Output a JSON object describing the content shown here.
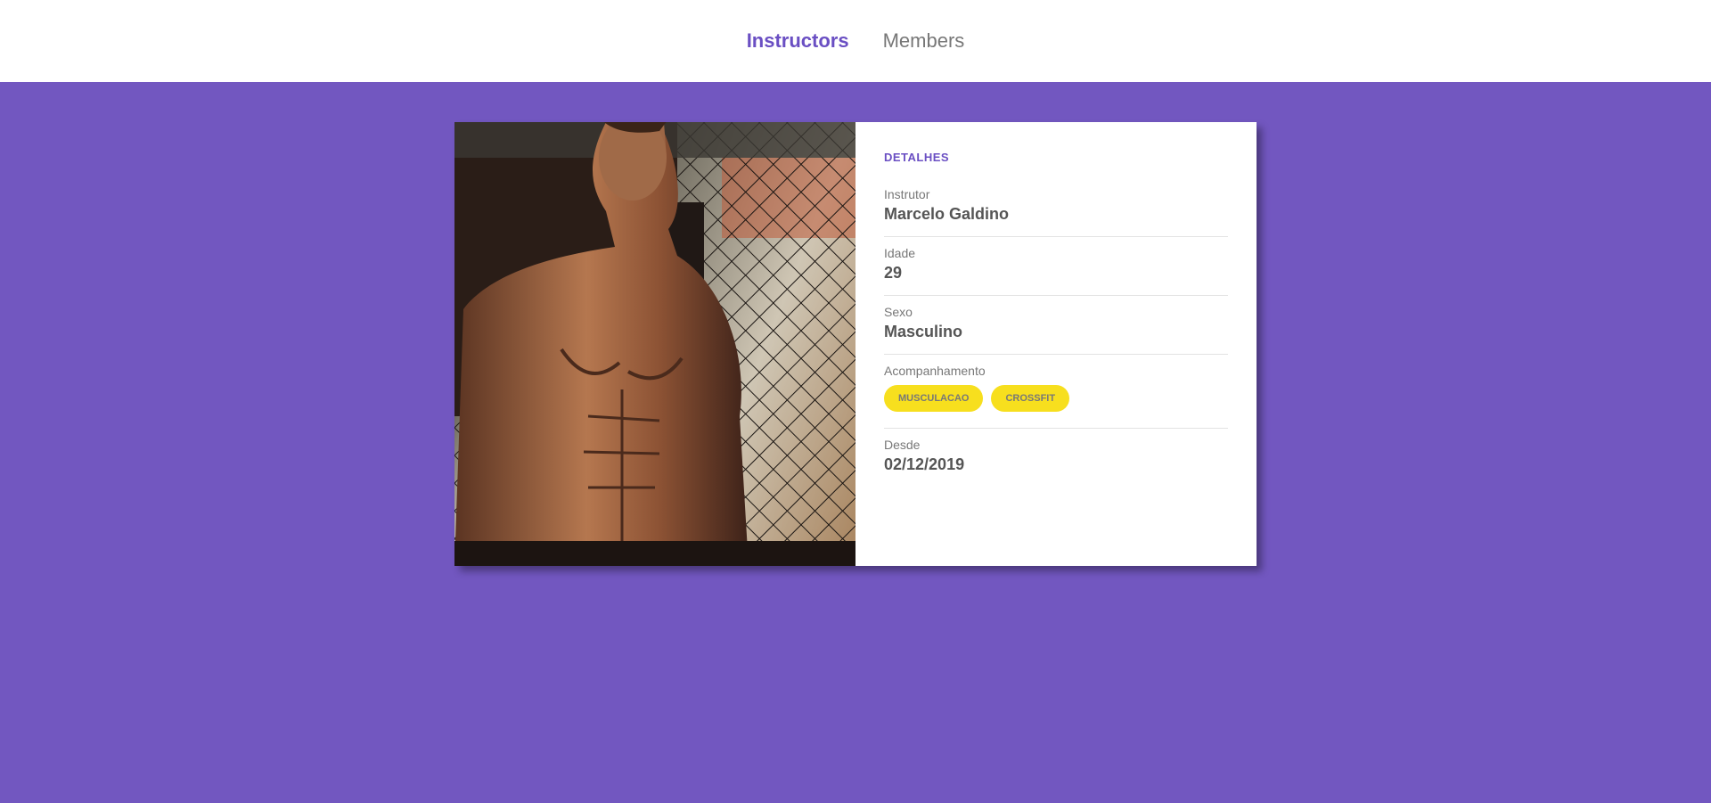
{
  "nav": {
    "instructors_label": "Instructors",
    "members_label": "Members"
  },
  "colors": {
    "background": "#7257c0",
    "accent": "#6a4fc3",
    "tag": "#f7df1e"
  },
  "card": {
    "photo_icon": "instructor-photo",
    "title": "DETALHES",
    "fields": {
      "instructor_label": "Instrutor",
      "instructor_value": "Marcelo Galdino",
      "age_label": "Idade",
      "age_value": "29",
      "gender_label": "Sexo",
      "gender_value": "Masculino",
      "services_label": "Acompanhamento",
      "services": [
        "MUSCULACAO",
        "CROSSFIT"
      ],
      "since_label": "Desde",
      "since_value": "02/12/2019"
    }
  }
}
